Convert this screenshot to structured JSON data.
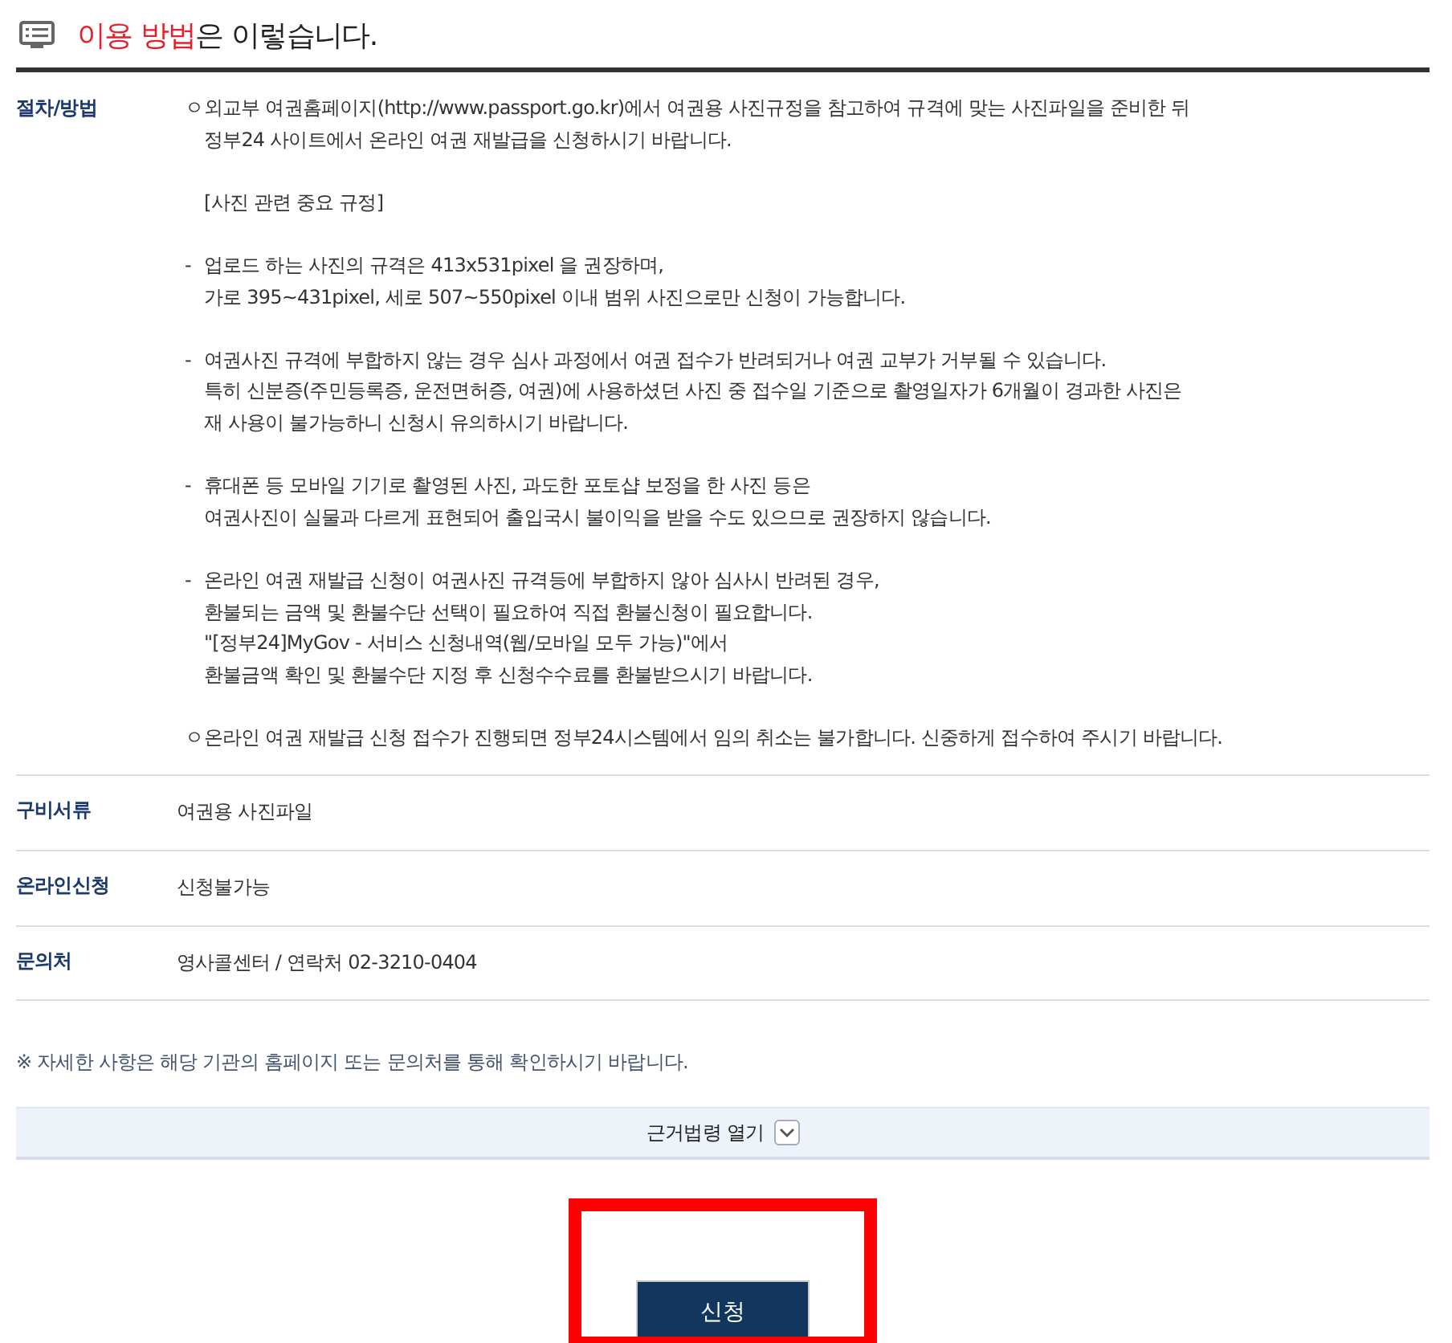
{
  "heading": {
    "highlight": "이용 방법",
    "rest": "은 이렇습니다."
  },
  "rows": [
    {
      "label": "절차/방법",
      "blocks": [
        {
          "marker": "ㅇ",
          "lines": [
            "외교부 여권홈페이지(http://www.passport.go.kr)에서 여권용 사진규정을 참고하여 규격에 맞는 사진파일을 준비한 뒤",
            "정부24 사이트에서 온라인 여권 재발급을 신청하시기 바랍니다."
          ]
        },
        {
          "lines": [
            "[사진 관련 중요 규정]"
          ]
        },
        {
          "marker": "-",
          "lines": [
            "업로드 하는 사진의 규격은 413x531pixel 을 권장하며,",
            "가로 395~431pixel, 세로 507~550pixel 이내 범위 사진으로만 신청이 가능합니다."
          ]
        },
        {
          "marker": "-",
          "lines": [
            "여권사진 규격에 부합하지 않는 경우 심사 과정에서 여권 접수가 반려되거나 여권 교부가 거부될 수 있습니다.",
            "특히 신분증(주민등록증, 운전면허증, 여권)에 사용하셨던 사진 중 접수일 기준으로 촬영일자가 6개월이 경과한 사진은",
            "재 사용이 불가능하니 신청시 유의하시기 바랍니다."
          ]
        },
        {
          "marker": "-",
          "lines": [
            "휴대폰 등 모바일 기기로 촬영된 사진, 과도한 포토샵 보정을 한 사진 등은",
            "여권사진이 실물과 다르게 표현되어 출입국시 불이익을 받을 수도 있으므로 권장하지 않습니다."
          ]
        },
        {
          "marker": "-",
          "lines": [
            "온라인 여권 재발급 신청이 여권사진 규격등에 부합하지 않아 심사시 반려된 경우,",
            "환불되는 금액 및 환불수단 선택이 필요하여 직접 환불신청이 필요합니다.",
            "\"[정부24]MyGov - 서비스 신청내역(웹/모바일 모두 가능)\"에서",
            "환불금액 확인 및 환불수단 지정 후 신청수수료를 환불받으시기 바랍니다."
          ]
        },
        {
          "marker": "ㅇ",
          "lines": [
            "온라인 여권 재발급 신청 접수가 진행되면 정부24시스템에서 임의 취소는 불가합니다. 신중하게 접수하여 주시기 바랍니다."
          ]
        }
      ]
    },
    {
      "label": "구비서류",
      "value": "여권용 사진파일"
    },
    {
      "label": "온라인신청",
      "value": "신청불가능"
    },
    {
      "label": "문의처",
      "value": "영사콜센터 / 연락처 02-3210-0404"
    }
  ],
  "note": "※ 자세한 사항은 해당 기관의 홈페이지 또는 문의처를 통해 확인하시기 바랍니다.",
  "law_toggle": {
    "label": "근거법령 열기",
    "expanded": false
  },
  "apply_button": "신청"
}
